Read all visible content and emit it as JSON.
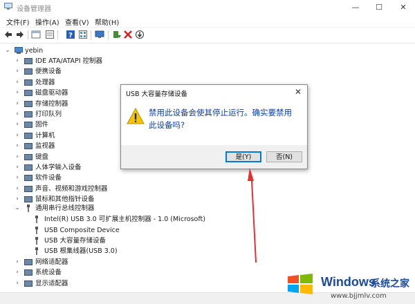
{
  "window": {
    "title": "设备管理器",
    "minimize": "—",
    "maximize": "☐",
    "close": "✕"
  },
  "menu": [
    "文件(F)",
    "操作(A)",
    "查看(V)",
    "帮助(H)"
  ],
  "toolbar_icons": [
    "back-arrow-icon",
    "forward-arrow-icon",
    "properties-icon",
    "driver-icon",
    "help-icon",
    "view-icon",
    "monitor-scan-icon",
    "update-driver-icon",
    "uninstall-icon",
    "download-icon"
  ],
  "tree": {
    "root": "yebin",
    "categories_top": [
      {
        "label": "IDE ATA/ATAPI 控制器",
        "icon": "ide-controller-icon"
      },
      {
        "label": "便携设备",
        "icon": "portable-device-icon"
      },
      {
        "label": "处理器",
        "icon": "processor-icon"
      },
      {
        "label": "磁盘驱动器",
        "icon": "disk-drive-icon"
      },
      {
        "label": "存储控制器",
        "icon": "storage-controller-icon"
      },
      {
        "label": "打印队列",
        "icon": "printer-icon"
      },
      {
        "label": "固件",
        "icon": "firmware-icon"
      },
      {
        "label": "计算机",
        "icon": "computer-icon"
      },
      {
        "label": "监视器",
        "icon": "monitor-icon"
      },
      {
        "label": "键盘",
        "icon": "keyboard-icon"
      },
      {
        "label": "人体学输入设备",
        "icon": "hid-icon"
      },
      {
        "label": "软件设备",
        "icon": "software-device-icon"
      },
      {
        "label": "声音、视频和游戏控制器",
        "icon": "sound-icon"
      },
      {
        "label": "鼠标和其他指针设备",
        "icon": "mouse-icon"
      }
    ],
    "usb_category": "通用串行总线控制器",
    "usb_children": [
      "Intel(R) USB 3.0 可扩展主机控制器 - 1.0 (Microsoft)",
      "USB Composite Device",
      "USB 大容量存储设备",
      "USB 根集线器(USB 3.0)"
    ],
    "categories_bottom": [
      {
        "label": "网络适配器",
        "icon": "network-adapter-icon"
      },
      {
        "label": "系统设备",
        "icon": "system-device-icon"
      },
      {
        "label": "显示适配器",
        "icon": "display-adapter-icon"
      }
    ]
  },
  "dialog": {
    "title": "USB 大容量存储设备",
    "close": "✕",
    "message_line1": "禁用此设备会使其停止运行。确实要禁用",
    "message_line2": "此设备吗?",
    "yes": "是(Y)",
    "no": "否(N)"
  },
  "watermark": {
    "brand": "Windows",
    "cn": "系统之家",
    "url": "www.bjjmlv.com"
  },
  "colors": {
    "accent": "#0078d7",
    "message": "#0b3fa8",
    "arrow": "#e53030",
    "warning": "#f5c400"
  }
}
